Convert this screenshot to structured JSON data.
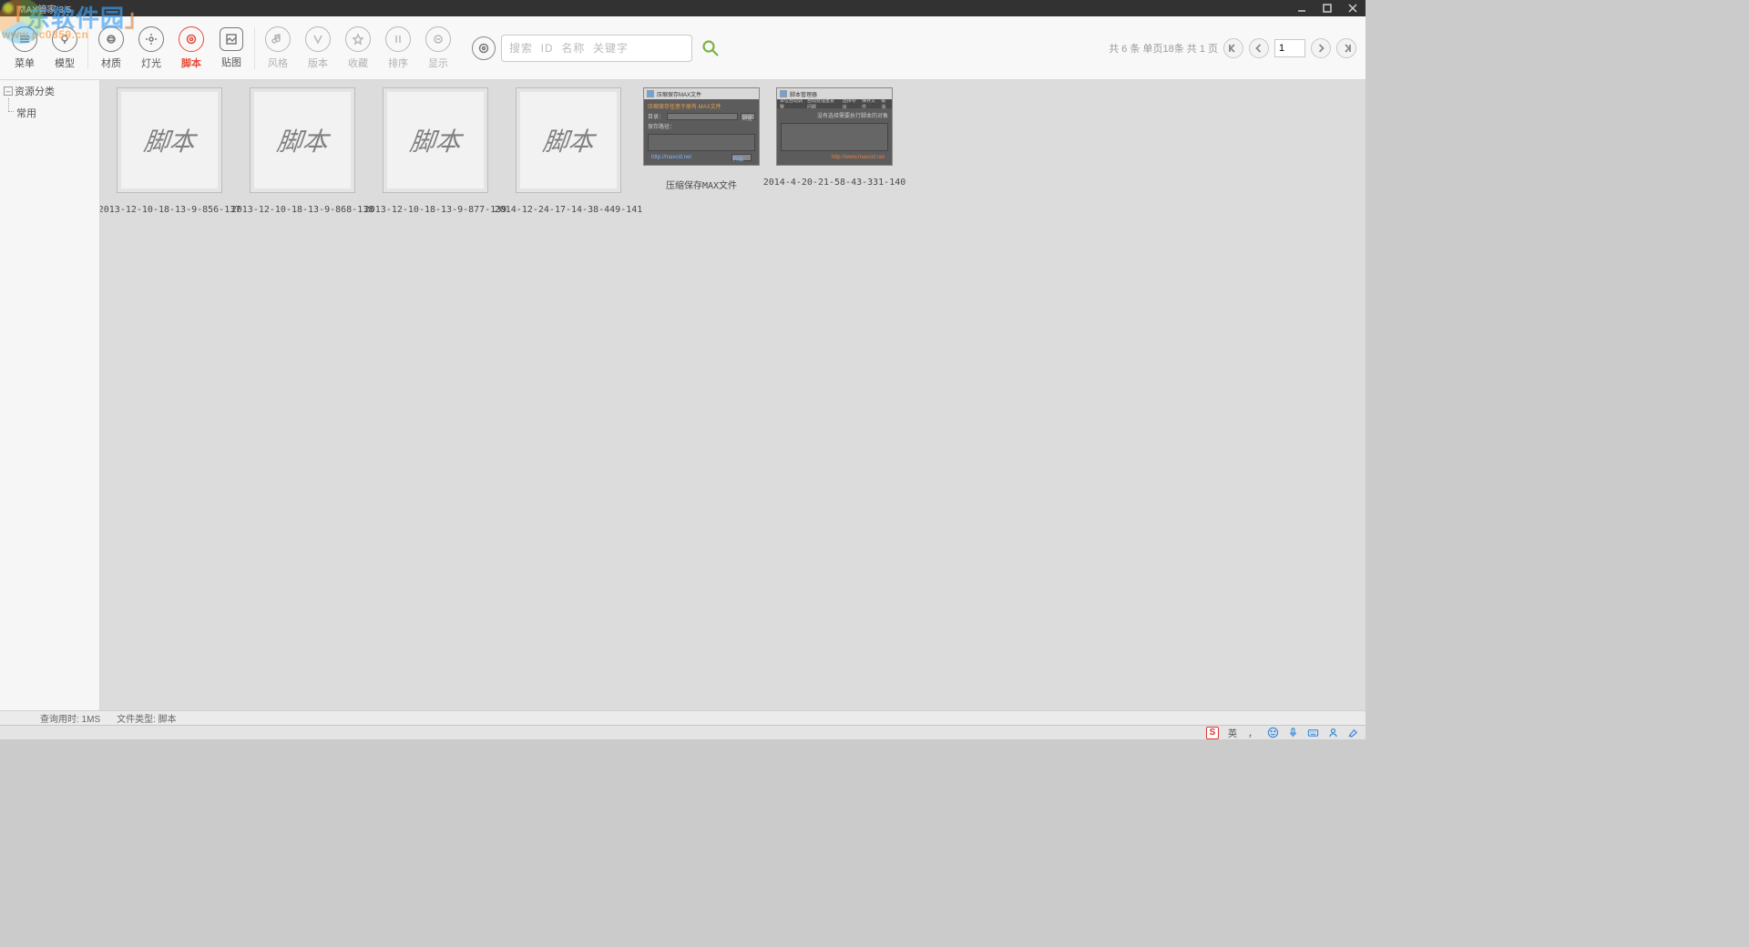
{
  "window": {
    "title": "MAX管家 3.5"
  },
  "watermark": {
    "text_cn": "东软件园",
    "text_prefix": "「",
    "text_suffix": "」",
    "url": "www.pc0359.cn"
  },
  "toolbar": {
    "items": [
      {
        "label": "菜单"
      },
      {
        "label": "模型"
      },
      {
        "label": "材质"
      },
      {
        "label": "灯光"
      },
      {
        "label": "脚本"
      },
      {
        "label": "贴图"
      },
      {
        "label": "风格"
      },
      {
        "label": "版本"
      },
      {
        "label": "收藏"
      },
      {
        "label": "排序"
      },
      {
        "label": "显示"
      }
    ],
    "search_placeholder": "搜索  ID  名称  关键字"
  },
  "pager": {
    "summary": "共 6 条 单页18条 共 1 页",
    "page": "1"
  },
  "sidebar": {
    "root": "资源分类",
    "children": [
      "常用"
    ]
  },
  "thumb_text": "脚本",
  "cards": [
    {
      "caption": "2013-12-10-18-13-9-856-137",
      "type": "script"
    },
    {
      "caption": "2013-12-10-18-13-9-868-138",
      "type": "script"
    },
    {
      "caption": "2013-12-10-18-13-9-877-139",
      "type": "script"
    },
    {
      "caption": "2014-12-24-17-14-38-449-141",
      "type": "script"
    },
    {
      "caption": "压缩保存MAX文件",
      "type": "dark1",
      "d": {
        "title": "压缩保存MAX文件",
        "l1": "压缩保存任意于原有.MAX文件",
        "l2": "目录：",
        "l3": "保存路径：",
        "btn": "浏览",
        "foot_l": "http://maxcid.net",
        "foot_r": "开始"
      }
    },
    {
      "caption": "2014-4-20-21-58-43-331-140",
      "type": "dark2",
      "d": {
        "title": "脚本管理器",
        "menu": [
          "单位自动调整",
          "自动处理重复问题",
          "选择导出",
          "保存文件",
          "取消"
        ],
        "body": "没有选择需要执行脚本的对象",
        "foot": "http://www.maxcid.net"
      }
    }
  ],
  "status": {
    "query": "查询用时: 1MS",
    "filetype": "文件类型: 脚本"
  },
  "tray": {
    "lang": "英",
    "comma": "，"
  }
}
